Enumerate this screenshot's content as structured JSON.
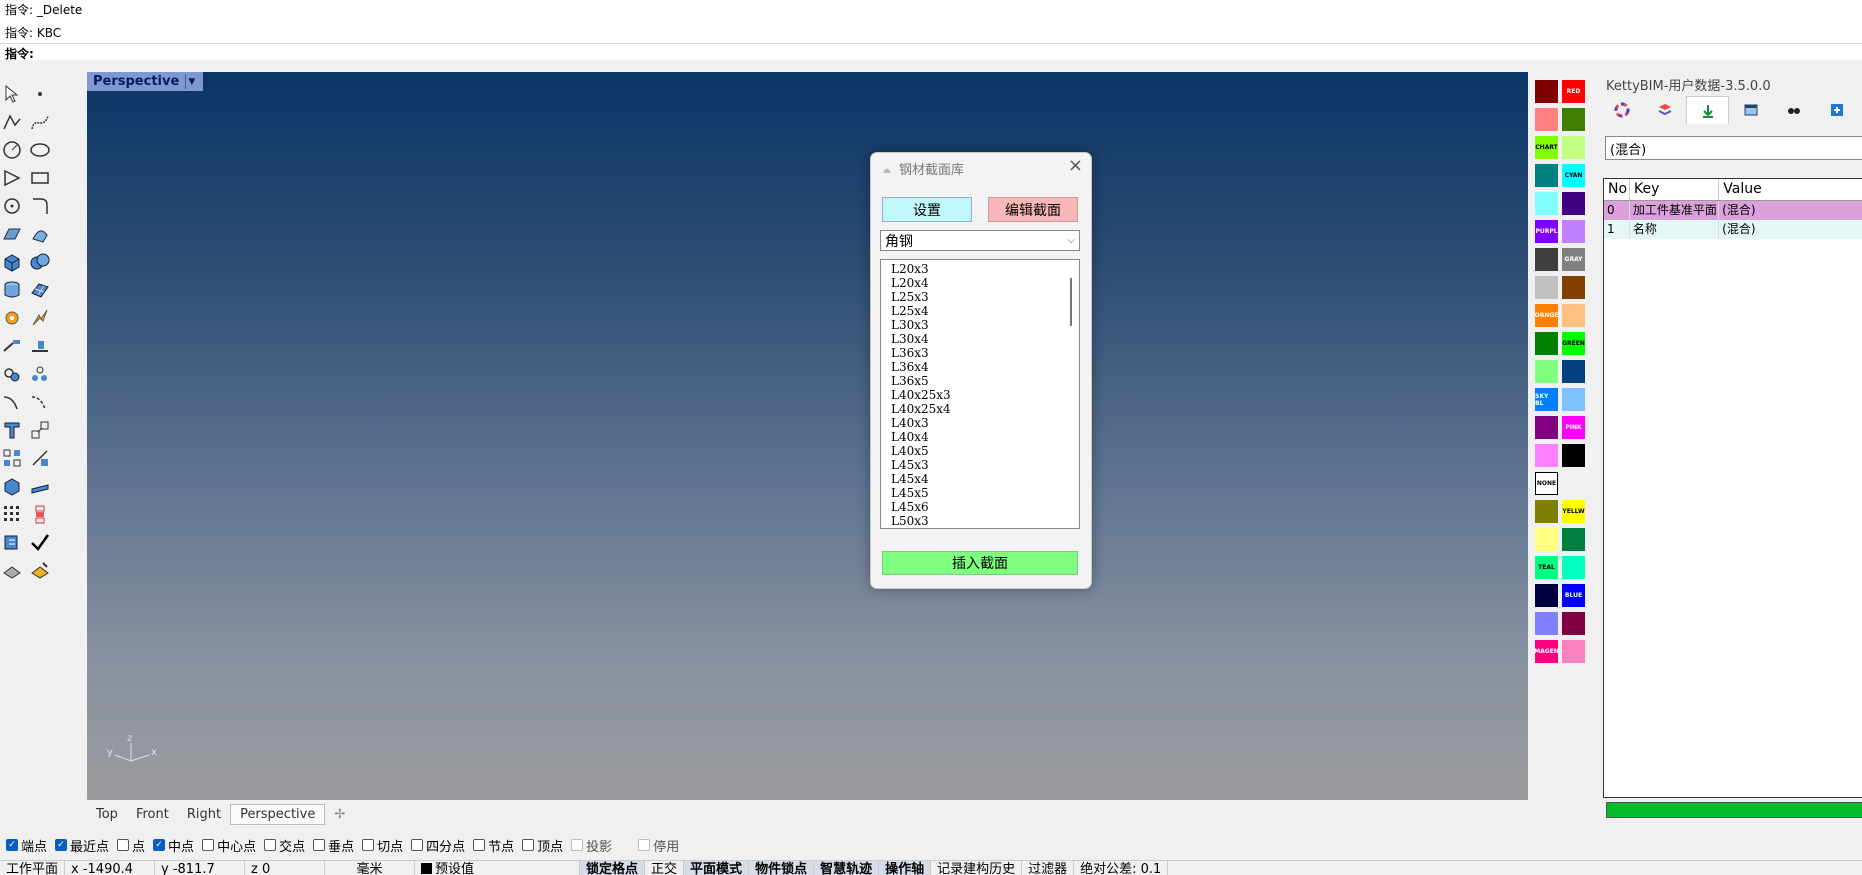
{
  "command_history": [
    "指令: _Delete",
    "指令: KBC"
  ],
  "command_prompt": "指令:",
  "viewport": {
    "title": "Perspective",
    "axes": {
      "x": "x",
      "y": "y",
      "z": "z"
    }
  },
  "viewport_tabs": [
    "Top",
    "Front",
    "Right",
    "Perspective"
  ],
  "osnap": [
    {
      "label": "端点",
      "checked": true
    },
    {
      "label": "最近点",
      "checked": true
    },
    {
      "label": "点",
      "checked": false
    },
    {
      "label": "中点",
      "checked": true
    },
    {
      "label": "中心点",
      "checked": false
    },
    {
      "label": "交点",
      "checked": false
    },
    {
      "label": "垂点",
      "checked": false
    },
    {
      "label": "切点",
      "checked": false
    },
    {
      "label": "四分点",
      "checked": false
    },
    {
      "label": "节点",
      "checked": false
    },
    {
      "label": "顶点",
      "checked": false
    },
    {
      "label": "投影",
      "checked": false
    },
    {
      "label": "停用",
      "checked": false
    }
  ],
  "statusbar": {
    "cplane": "工作平面",
    "x": "x -1490.4",
    "y": "y -811.7",
    "z": "z 0",
    "units": "毫米",
    "layer": "预设值",
    "grid_snap": "锁定格点",
    "ortho": "正交",
    "planar": "平面模式",
    "osnap": "物件锁点",
    "smarttrack": "智慧轨迹",
    "gumball": "操作轴",
    "history": "记录建构历史",
    "filter": "过滤器",
    "tolerance": "绝对公差: 0.1"
  },
  "palette": [
    {
      "color": "#800000",
      "label": ""
    },
    {
      "color": "#ff0000",
      "label": "RED"
    },
    {
      "color": "#ff8080",
      "label": ""
    },
    {
      "color": "#408000",
      "label": ""
    },
    {
      "color": "#80ff00",
      "label": "CHART"
    },
    {
      "color": "#c0ff80",
      "label": ""
    },
    {
      "color": "#008080",
      "label": ""
    },
    {
      "color": "#00ffff",
      "label": "CYAN"
    },
    {
      "color": "#80ffff",
      "label": ""
    },
    {
      "color": "#400080",
      "label": ""
    },
    {
      "color": "#8000ff",
      "label": "PURPL"
    },
    {
      "color": "#c080ff",
      "label": ""
    },
    {
      "color": "#404040",
      "label": ""
    },
    {
      "color": "#808080",
      "label": "GRAY"
    },
    {
      "color": "#c0c0c0",
      "label": ""
    },
    {
      "color": "#804000",
      "label": ""
    },
    {
      "color": "#ff8000",
      "label": "ORNGE"
    },
    {
      "color": "#ffc080",
      "label": ""
    },
    {
      "color": "#008000",
      "label": ""
    },
    {
      "color": "#00ff00",
      "label": "GREEN"
    },
    {
      "color": "#80ff80",
      "label": ""
    },
    {
      "color": "#004080",
      "label": ""
    },
    {
      "color": "#0080ff",
      "label": "SKY BL"
    },
    {
      "color": "#80c0ff",
      "label": ""
    },
    {
      "color": "#800080",
      "label": ""
    },
    {
      "color": "#ff00ff",
      "label": "PINK"
    },
    {
      "color": "#ff80ff",
      "label": ""
    },
    {
      "color": "#000000",
      "label": ""
    },
    {
      "color": "#ffffff",
      "label": "NONE"
    },
    {
      "color": "#f0f0f0",
      "label": ""
    },
    {
      "color": "#808000",
      "label": ""
    },
    {
      "color": "#ffff00",
      "label": "YELLW"
    },
    {
      "color": "#ffff80",
      "label": ""
    },
    {
      "color": "#008040",
      "label": ""
    },
    {
      "color": "#00ff80",
      "label": "TEAL"
    },
    {
      "color": "#00ffc0",
      "label": ""
    },
    {
      "color": "#000040",
      "label": ""
    },
    {
      "color": "#0000ff",
      "label": "BLUE"
    },
    {
      "color": "#8080ff",
      "label": ""
    },
    {
      "color": "#800040",
      "label": ""
    },
    {
      "color": "#ff0080",
      "label": "MAGEN"
    },
    {
      "color": "#ff80c0",
      "label": ""
    }
  ],
  "panel": {
    "title": "KettyBIM-用户数据-3.5.0.0",
    "selector": "(混合)",
    "columns": [
      "No",
      "Key",
      "Value"
    ],
    "rows": [
      {
        "no": "0",
        "key": "加工件基准平面",
        "value": "(混合)"
      },
      {
        "no": "1",
        "key": "名称",
        "value": "(混合)"
      }
    ]
  },
  "dialog": {
    "title": "钢材截面库",
    "settings_button": "设置",
    "edit_button": "编辑截面",
    "category": "角钢",
    "sections": [
      "L20x3",
      "L20x4",
      "L25x3",
      "L25x4",
      "L30x3",
      "L30x4",
      "L36x3",
      "L36x4",
      "L36x5",
      "L40x25x3",
      "L40x25x4",
      "L40x3",
      "L40x4",
      "L40x5",
      "L45x3",
      "L45x4",
      "L45x5",
      "L45x6",
      "L50x3"
    ],
    "insert_button": "插入截面"
  }
}
